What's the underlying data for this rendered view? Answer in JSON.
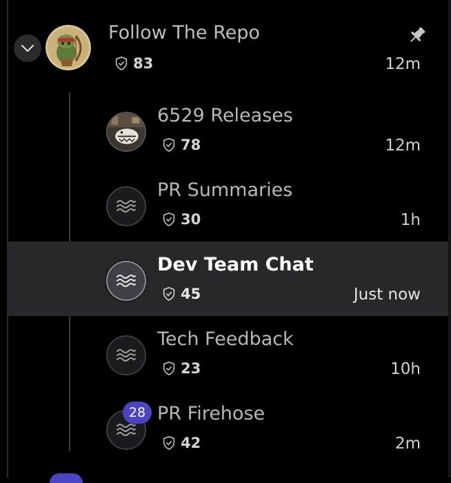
{
  "group": {
    "name": "Follow The Repo",
    "count": "83",
    "time": "12m"
  },
  "channels": [
    {
      "name": "6529 Releases",
      "count": "78",
      "time": "12m",
      "active": false
    },
    {
      "name": "PR Summaries",
      "count": "30",
      "time": "1h",
      "active": false
    },
    {
      "name": "Dev Team Chat",
      "count": "45",
      "time": "Just now",
      "active": true
    },
    {
      "name": "Tech Feedback",
      "count": "23",
      "time": "10h",
      "active": false
    },
    {
      "name": "PR Firehose",
      "count": "42",
      "time": "2m",
      "active": false,
      "unread_badge": "28"
    }
  ],
  "icons": {
    "expand": "chevron-down-icon",
    "pin": "pin-icon",
    "shield": "shield-check-icon",
    "wave": "wave-icon"
  },
  "colors": {
    "background": "#000000",
    "active_row": "#28282b",
    "badge": "#4b44c4"
  }
}
